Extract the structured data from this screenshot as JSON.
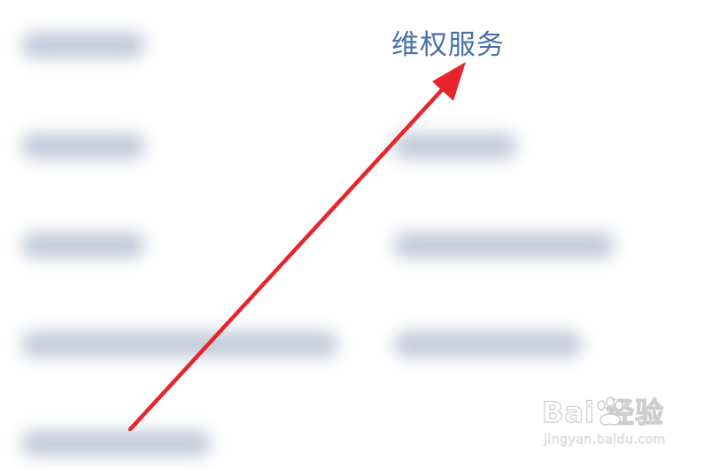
{
  "focus_item": {
    "label": "维权服务",
    "color": "#4a6fa5"
  },
  "blurred_items_count_note_free": true,
  "arrow": {
    "color": "#e8232b"
  },
  "watermark": {
    "brand": "Bai  经验",
    "site": "jingyan.baidu.com"
  }
}
